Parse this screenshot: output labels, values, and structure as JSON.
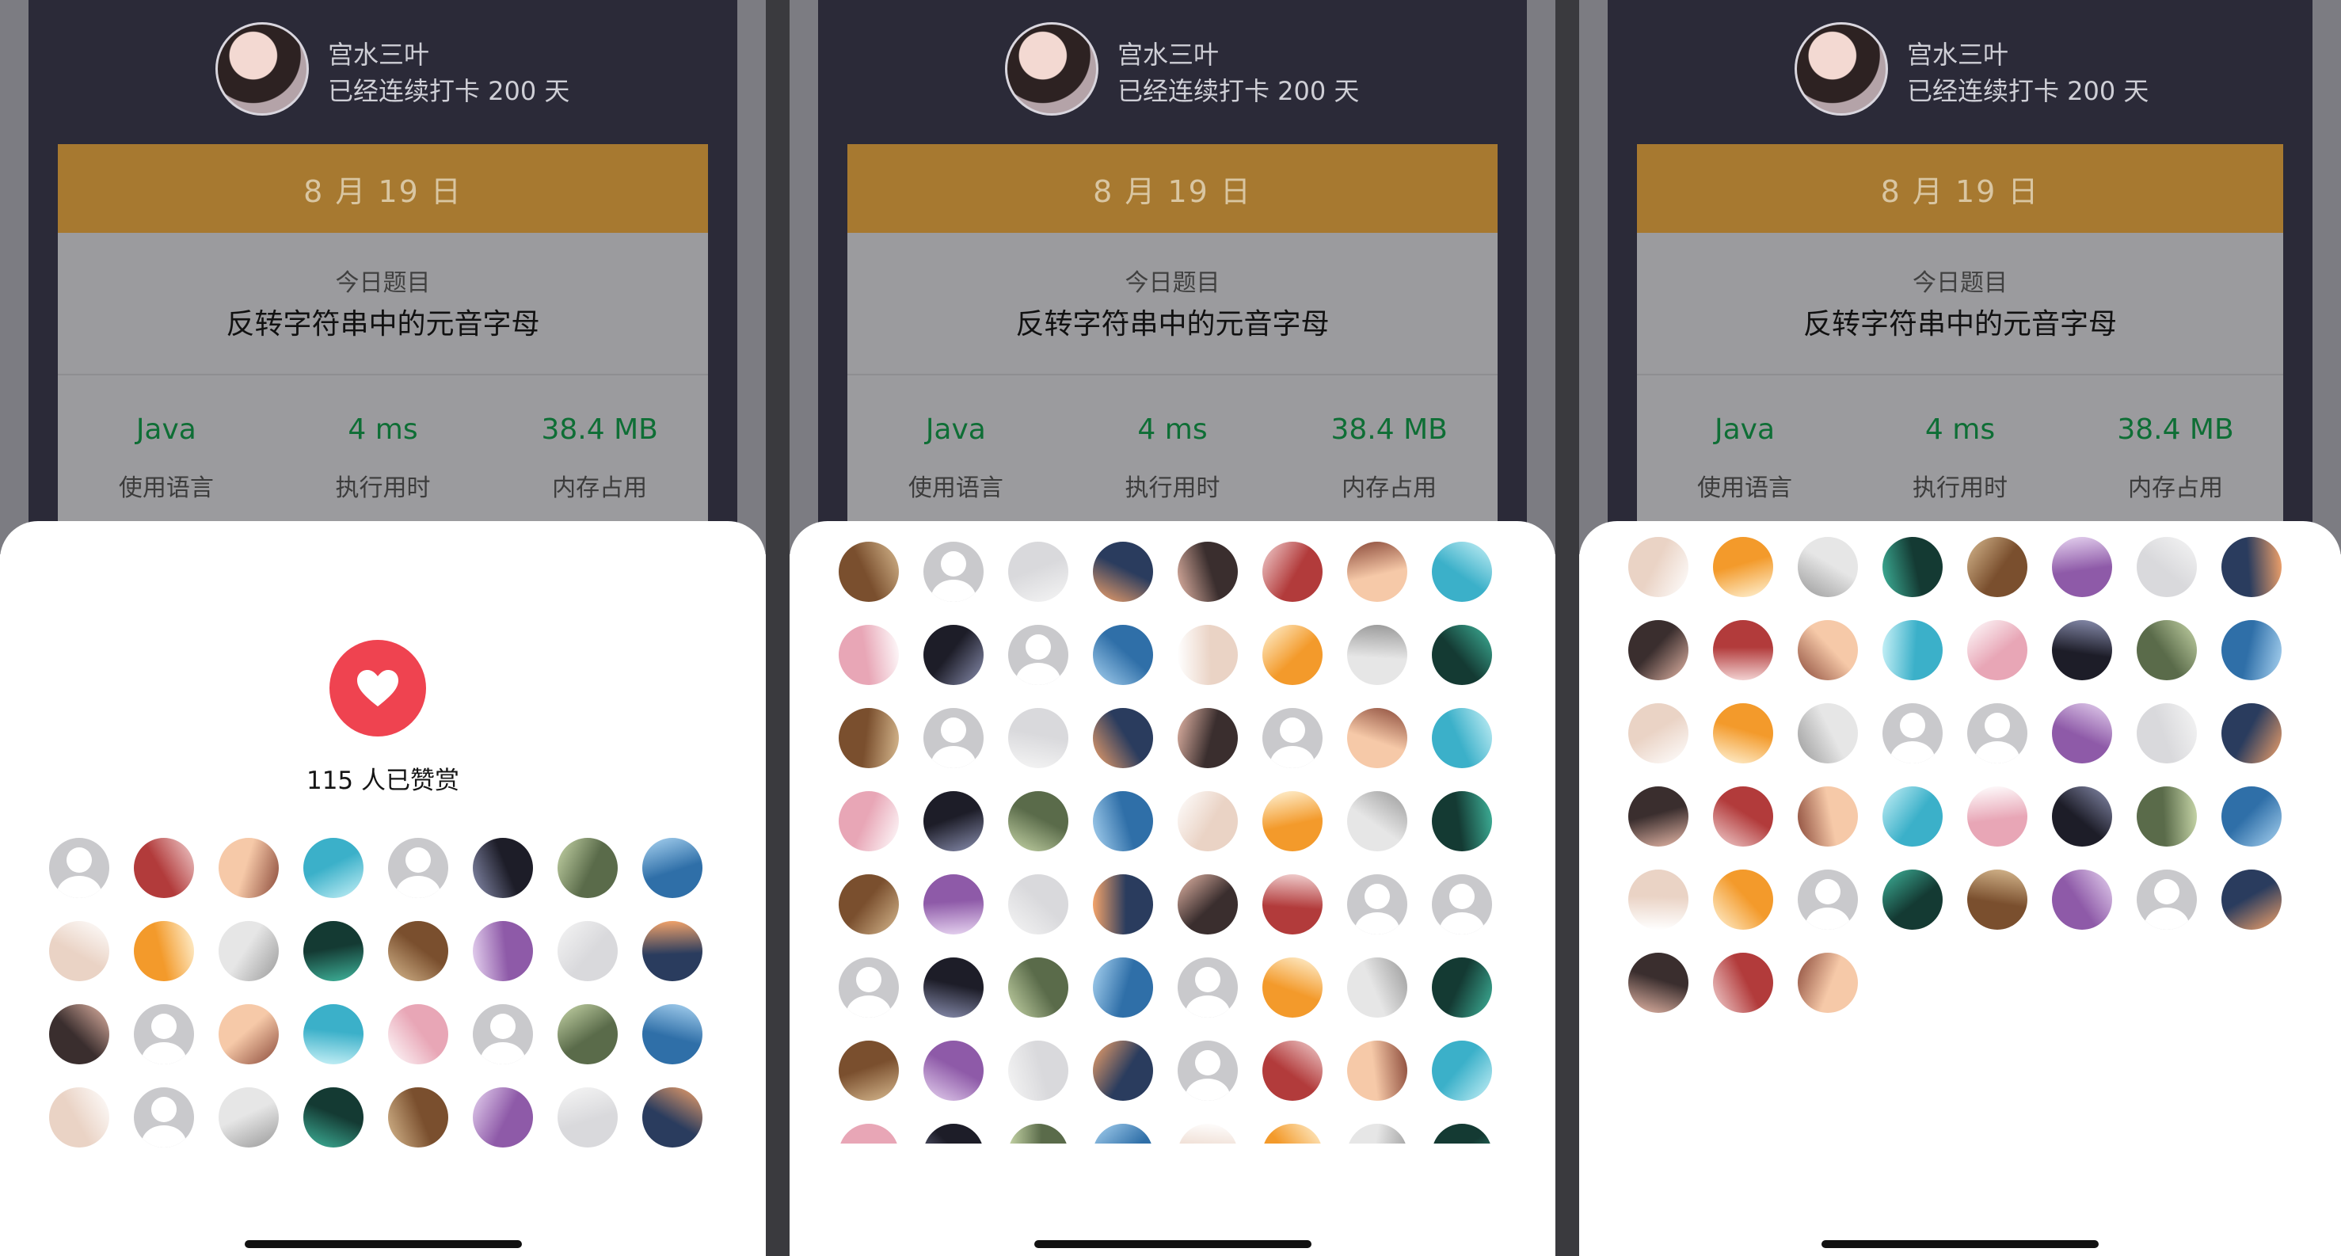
{
  "profile": {
    "username": "宫水三叶",
    "streak": "已经连续打卡 200 天"
  },
  "card": {
    "date": "8 月 19 日",
    "question_label": "今日题目",
    "question_title": "反转字符串中的元音字母",
    "stats": [
      {
        "value": "Java",
        "label": "使用语言"
      },
      {
        "value": "4 ms",
        "label": "执行用时"
      },
      {
        "value": "38.4 MB",
        "label": "内存占用"
      }
    ]
  },
  "reward": {
    "icon": "heart-icon",
    "count_text": "115 人已赞赏",
    "accent": "#ef4350"
  },
  "screens": [
    {
      "name": "screen-1"
    },
    {
      "name": "screen-2"
    },
    {
      "name": "screen-3"
    }
  ],
  "avatar_counts": {
    "screen1": 32,
    "screen2": 64,
    "screen3": 43
  },
  "colors": {
    "date_bar": "#a77930",
    "stat_value": "#0e6e35",
    "sheet_bg": "#ffffff",
    "dark_header": "#2b2a38"
  }
}
